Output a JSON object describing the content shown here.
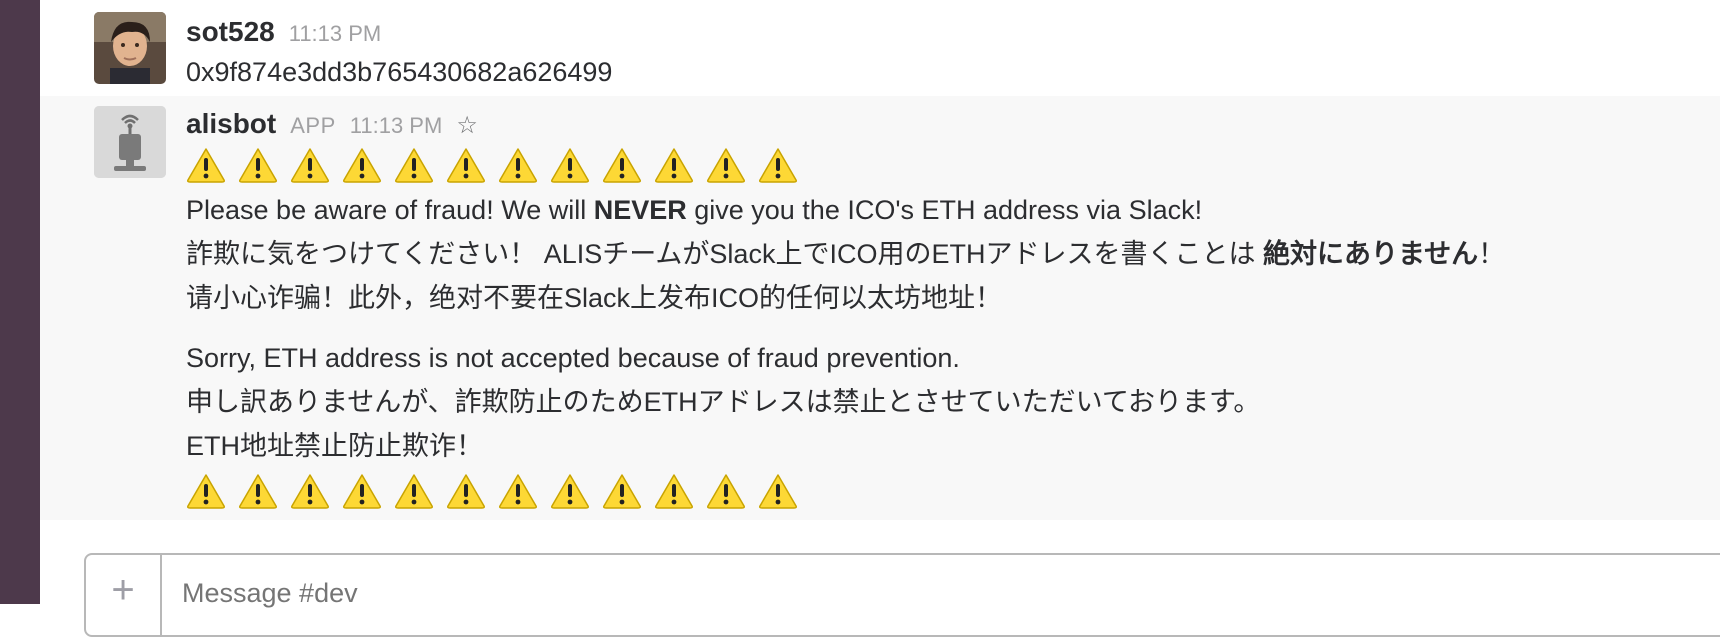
{
  "messages": [
    {
      "username": "sot528",
      "timestamp": "11:13 PM",
      "avatar_icon": "user-photo-avatar",
      "text": "0x9f874e3dd3b765430682a626499"
    },
    {
      "username": "alisbot",
      "app_tag": "APP",
      "timestamp": "11:13 PM",
      "star_icon": "star-outline-icon",
      "avatar_icon": "robot-avatar",
      "warning_count": 12,
      "line1_before": "Please be aware of fraud! We will ",
      "line1_bold": "NEVER",
      "line1_after": " give you the ICO's ETH address via Slack!",
      "line2_before": "詐欺に気をつけてください！ ALISチームがSlack上でICO用のETHアドレスを書くことは ",
      "line2_bold": "絶対にありません",
      "line2_after": "！",
      "line3": "请小心诈骗！此外，绝对不要在Slack上发布ICO的任何以太坊地址！",
      "line4": "Sorry, ETH address is not accepted because of fraud prevention.",
      "line5": "申し訳ありませんが、詐欺防止のためETHアドレスは禁止とさせていただいております。",
      "line6": "ETH地址禁止防止欺诈！"
    }
  ],
  "composer": {
    "plus_label": "+",
    "placeholder": "Message #dev"
  },
  "colors": {
    "sidebar": "#4d394b",
    "warning_yellow": "#fdd835",
    "muted_text": "#a0a0a2"
  }
}
